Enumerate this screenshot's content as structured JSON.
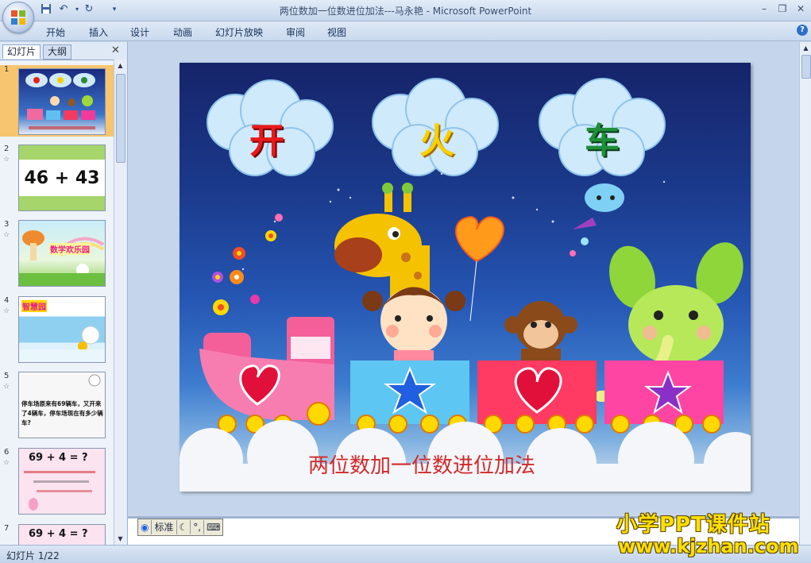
{
  "window": {
    "title": "两位数加一位数进位加法---马永艳 - Microsoft PowerPoint"
  },
  "quick_access": [
    {
      "icon": "save-icon"
    },
    {
      "icon": "undo-icon"
    },
    {
      "icon": "redo-icon"
    },
    {
      "icon": "customize-icon"
    }
  ],
  "ribbon": {
    "tabs": [
      "开始",
      "插入",
      "设计",
      "动画",
      "幻灯片放映",
      "审阅",
      "视图"
    ]
  },
  "pane": {
    "tab_slides": "幻灯片",
    "tab_outline": "大纲",
    "close": "✕"
  },
  "thumbnails": [
    {
      "num": "1",
      "text": ""
    },
    {
      "num": "2",
      "text": "46 + 43"
    },
    {
      "num": "3",
      "text": "数学欢乐园"
    },
    {
      "num": "4",
      "text": "智慧园"
    },
    {
      "num": "5",
      "text": "停车场原来有69辆车，又开来了4辆车，停车场现在有多少辆车?"
    },
    {
      "num": "6",
      "text": "69 + 4 = ?"
    },
    {
      "num": "7",
      "text": "69 + 4 = ?"
    }
  ],
  "slide": {
    "cloud_chars": [
      "开",
      "火",
      "车"
    ],
    "title": "两位数加一位数进位加法"
  },
  "ime": {
    "label": "标准"
  },
  "status": {
    "text": "幻灯片 1/22"
  },
  "watermark": {
    "line1": "小学PPT课件站",
    "line2": "www.kjzhan.com"
  },
  "colors": {
    "title_red": "#d12a2a",
    "selection": "#f7c46f",
    "watermark": "#ffe000"
  }
}
